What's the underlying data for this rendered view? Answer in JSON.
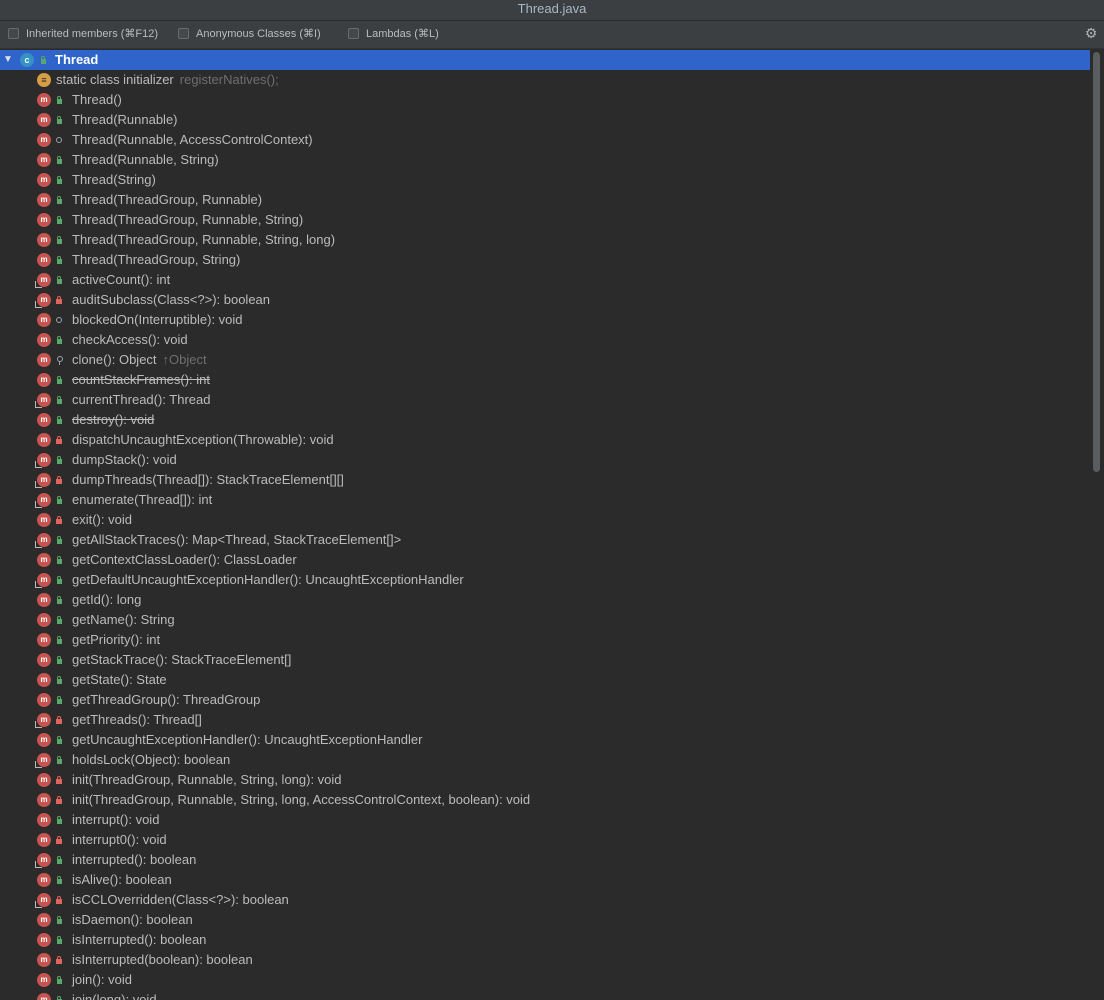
{
  "window": {
    "title": "Thread.java"
  },
  "toolbar": {
    "inherited_label": "Inherited members (⌘F12)",
    "anonymous_label": "Anonymous Classes (⌘I)",
    "lambdas_label": "Lambdas (⌘L)"
  },
  "tree": {
    "root": {
      "label": "Thread",
      "icon": "class-icon"
    },
    "initializer": {
      "label": "static class initializer",
      "hint": "registerNatives();"
    },
    "members": [
      {
        "label": "Thread()",
        "access": "public"
      },
      {
        "label": "Thread(Runnable)",
        "access": "public"
      },
      {
        "label": "Thread(Runnable, AccessControlContext)",
        "access": "package"
      },
      {
        "label": "Thread(Runnable, String)",
        "access": "public"
      },
      {
        "label": "Thread(String)",
        "access": "public"
      },
      {
        "label": "Thread(ThreadGroup, Runnable)",
        "access": "public"
      },
      {
        "label": "Thread(ThreadGroup, Runnable, String)",
        "access": "public"
      },
      {
        "label": "Thread(ThreadGroup, Runnable, String, long)",
        "access": "public"
      },
      {
        "label": "Thread(ThreadGroup, String)",
        "access": "public"
      },
      {
        "label": "activeCount(): int",
        "access": "public",
        "static": true
      },
      {
        "label": "auditSubclass(Class<?>): boolean",
        "access": "private",
        "static": true
      },
      {
        "label": "blockedOn(Interruptible): void",
        "access": "package"
      },
      {
        "label": "checkAccess(): void",
        "access": "public"
      },
      {
        "label": "clone(): Object",
        "access": "protected",
        "hint": "↑Object"
      },
      {
        "label": "countStackFrames(): int",
        "access": "public",
        "deprecated": true
      },
      {
        "label": "currentThread(): Thread",
        "access": "public",
        "static": true
      },
      {
        "label": "destroy(): void",
        "access": "public",
        "deprecated": true
      },
      {
        "label": "dispatchUncaughtException(Throwable): void",
        "access": "private"
      },
      {
        "label": "dumpStack(): void",
        "access": "public",
        "static": true
      },
      {
        "label": "dumpThreads(Thread[]): StackTraceElement[][]",
        "access": "private",
        "static": true
      },
      {
        "label": "enumerate(Thread[]): int",
        "access": "public",
        "static": true
      },
      {
        "label": "exit(): void",
        "access": "private"
      },
      {
        "label": "getAllStackTraces(): Map<Thread, StackTraceElement[]>",
        "access": "public",
        "static": true
      },
      {
        "label": "getContextClassLoader(): ClassLoader",
        "access": "public"
      },
      {
        "label": "getDefaultUncaughtExceptionHandler(): UncaughtExceptionHandler",
        "access": "public",
        "static": true
      },
      {
        "label": "getId(): long",
        "access": "public"
      },
      {
        "label": "getName(): String",
        "access": "public"
      },
      {
        "label": "getPriority(): int",
        "access": "public"
      },
      {
        "label": "getStackTrace(): StackTraceElement[]",
        "access": "public"
      },
      {
        "label": "getState(): State",
        "access": "public"
      },
      {
        "label": "getThreadGroup(): ThreadGroup",
        "access": "public"
      },
      {
        "label": "getThreads(): Thread[]",
        "access": "private",
        "static": true
      },
      {
        "label": "getUncaughtExceptionHandler(): UncaughtExceptionHandler",
        "access": "public"
      },
      {
        "label": "holdsLock(Object): boolean",
        "access": "public",
        "static": true
      },
      {
        "label": "init(ThreadGroup, Runnable, String, long): void",
        "access": "private"
      },
      {
        "label": "init(ThreadGroup, Runnable, String, long, AccessControlContext, boolean): void",
        "access": "private"
      },
      {
        "label": "interrupt(): void",
        "access": "public"
      },
      {
        "label": "interrupt0(): void",
        "access": "private"
      },
      {
        "label": "interrupted(): boolean",
        "access": "public",
        "static": true
      },
      {
        "label": "isAlive(): boolean",
        "access": "public"
      },
      {
        "label": "isCCLOverridden(Class<?>): boolean",
        "access": "private",
        "static": true
      },
      {
        "label": "isDaemon(): boolean",
        "access": "public"
      },
      {
        "label": "isInterrupted(): boolean",
        "access": "public"
      },
      {
        "label": "isInterrupted(boolean): boolean",
        "access": "private"
      },
      {
        "label": "join(): void",
        "access": "public"
      },
      {
        "label": "join(long): void",
        "access": "public"
      }
    ]
  },
  "colors": {
    "background": "#2b2b2b",
    "selection": "#2f65ca",
    "method_icon": "#c75450",
    "class_icon": "#3592c4",
    "public": "#59a869",
    "private": "#e0645c"
  }
}
